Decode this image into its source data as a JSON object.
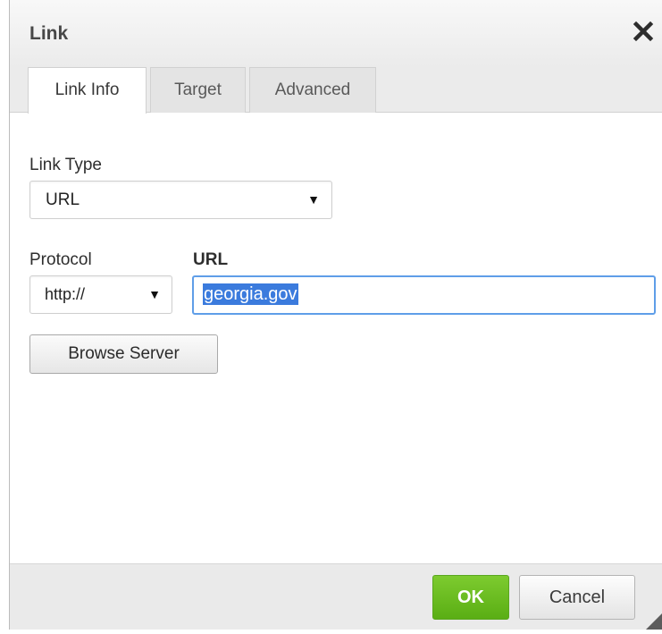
{
  "dialog": {
    "title": "Link",
    "tabs": [
      {
        "label": "Link Info",
        "active": true
      },
      {
        "label": "Target",
        "active": false
      },
      {
        "label": "Advanced",
        "active": false
      }
    ]
  },
  "link_info": {
    "link_type_label": "Link Type",
    "link_type_value": "URL",
    "protocol_label": "Protocol",
    "protocol_value": "http://",
    "url_label": "URL",
    "url_value": "georgia.gov",
    "browse_server_label": "Browse Server"
  },
  "footer": {
    "ok_label": "OK",
    "cancel_label": "Cancel"
  },
  "icons": {
    "close": "close-icon",
    "dropdown": "dropdown-arrow-icon",
    "resize": "resize-grip-icon"
  },
  "colors": {
    "ok_button": "#68b81e",
    "url_focus_border": "#5f9ee8",
    "text_selection": "#3b7bdd"
  }
}
